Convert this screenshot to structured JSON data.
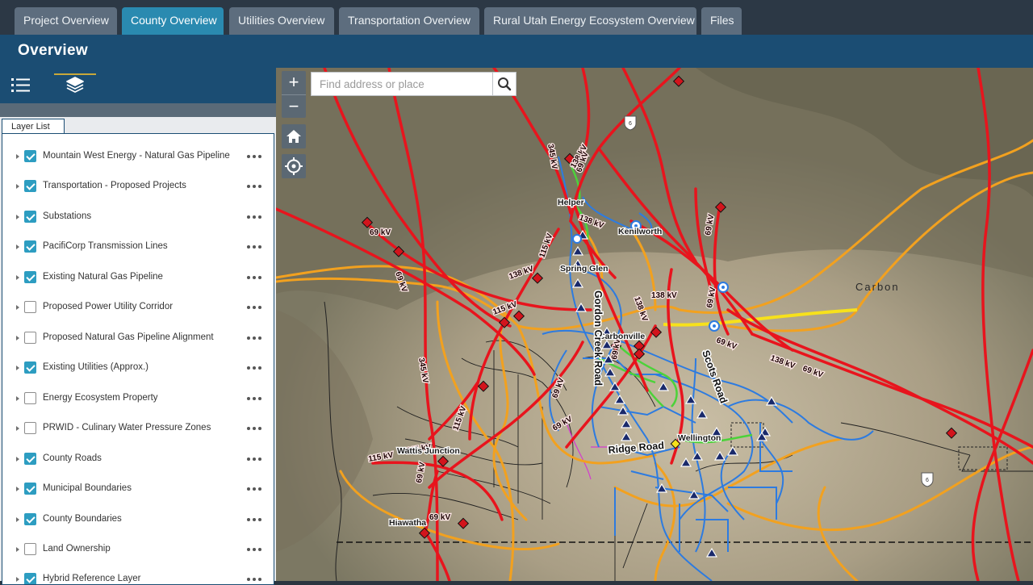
{
  "tabs": [
    {
      "label": "Project Overview",
      "active": false
    },
    {
      "label": "County Overview",
      "active": true
    },
    {
      "label": "Utilities Overview",
      "active": false
    },
    {
      "label": "Transportation Overview",
      "active": false
    },
    {
      "label": "Rural Utah Energy Ecosystem Overview",
      "active": false
    },
    {
      "label": "Files",
      "active": false
    }
  ],
  "header": {
    "title": "Overview"
  },
  "panel": {
    "tools": [
      {
        "icon": "list-icon"
      },
      {
        "icon": "layers-icon",
        "active": true
      }
    ],
    "layer_list_title": "Layer List",
    "layers": [
      {
        "label": "Mountain West Energy - Natural Gas Pipeline",
        "checked": true
      },
      {
        "label": "Transportation - Proposed Projects",
        "checked": true
      },
      {
        "label": "Substations",
        "checked": true
      },
      {
        "label": "PacifiCorp Transmission Lines",
        "checked": true
      },
      {
        "label": "Existing Natural Gas Pipeline",
        "checked": true
      },
      {
        "label": "Proposed Power Utility Corridor",
        "checked": false
      },
      {
        "label": "Proposed Natural Gas Pipeline Alignment",
        "checked": false
      },
      {
        "label": "Existing Utilities (Approx.)",
        "checked": true
      },
      {
        "label": "Energy Ecosystem Property",
        "checked": false
      },
      {
        "label": "PRWID - Culinary Water Pressure Zones",
        "checked": false
      },
      {
        "label": "County Roads",
        "checked": true
      },
      {
        "label": "Municipal Boundaries",
        "checked": true
      },
      {
        "label": "County Boundaries",
        "checked": true
      },
      {
        "label": "Land Ownership",
        "checked": false
      },
      {
        "label": "Hybrid Reference Layer",
        "checked": true
      }
    ]
  },
  "map": {
    "search_placeholder": "Find address or place",
    "zoom_in": "+",
    "zoom_out": "−",
    "labels": {
      "carbon": "Carbon",
      "gordon_creek_road": "Gordon Creek Road",
      "scots_road": "Scots Road",
      "ridge_road": "Ridge Road",
      "kenilworth": "Kenilworth",
      "helper": "Helper",
      "spring_glen": "Spring Glen",
      "hiawatha": "Hiawatha",
      "wellington": "Wellington",
      "carbonville": "Carbonville",
      "wattis_junction": "Wattis Junction"
    },
    "kv_labels": [
      "345 kV",
      "138 kV",
      "69 kV",
      "138 kV",
      "115 kV",
      "69 kV",
      "69 kV",
      "138 kV",
      "138 kV",
      "138 kV",
      "69 kV",
      "69 kV",
      "115 kV",
      "69 kV",
      "345 kV",
      "69 kV",
      "115 kV",
      "115 kV",
      "115 kV",
      "69 kV",
      "69 kV",
      "69 kV",
      "69 kV",
      "138 kV",
      "69 kV"
    ],
    "shields": [
      "6",
      "6"
    ],
    "colors": {
      "transmission": "#e8141d",
      "gas_pipeline": "#f2a11f",
      "utilities": "#2d7be0",
      "roads": "#1f1f1f",
      "proposed": "#4cd23a"
    }
  }
}
